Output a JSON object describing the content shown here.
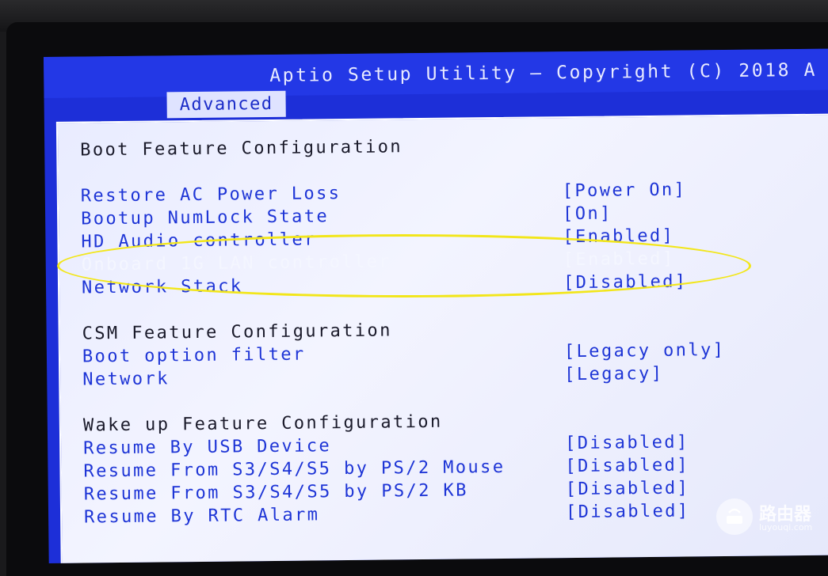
{
  "window": {
    "title": "Aptio Setup Utility – Copyright (C) 2018 A",
    "active_tab": "Advanced"
  },
  "sections": [
    {
      "heading": "Boot Feature Configuration",
      "items": [
        {
          "label": "Restore AC Power Loss",
          "value": "[Power On]"
        },
        {
          "label": "Bootup NumLock State",
          "value": "[On]"
        },
        {
          "label": "HD Audio controller",
          "value": "[Enabled]"
        },
        {
          "label": "Onboard 1G LAN controller",
          "value": "[Enabled]",
          "selected": true
        },
        {
          "label": "Network Stack",
          "value": "[Disabled]"
        }
      ]
    },
    {
      "heading": "CSM Feature Configuration",
      "items": [
        {
          "label": "Boot option filter",
          "value": "[Legacy only]"
        },
        {
          "label": "Network",
          "value": "[Legacy]"
        }
      ]
    },
    {
      "heading": "Wake up Feature Configuration",
      "items": [
        {
          "label": "Resume By USB Device",
          "value": "[Disabled]"
        },
        {
          "label": "Resume From S3/S4/S5 by PS/2 Mouse",
          "value": "[Disabled]"
        },
        {
          "label": "Resume From S3/S4/S5 by PS/2 KB",
          "value": "[Disabled]"
        },
        {
          "label": "Resume By RTC Alarm",
          "value": "[Disabled]"
        }
      ]
    }
  ],
  "watermark": {
    "name": "路由器",
    "site": "luyouqi.com"
  },
  "colors": {
    "bios_blue": "#1d2fd8",
    "panel": "#eceeff",
    "item_text": "#1e35d6",
    "highlight": "#f2e61a"
  }
}
